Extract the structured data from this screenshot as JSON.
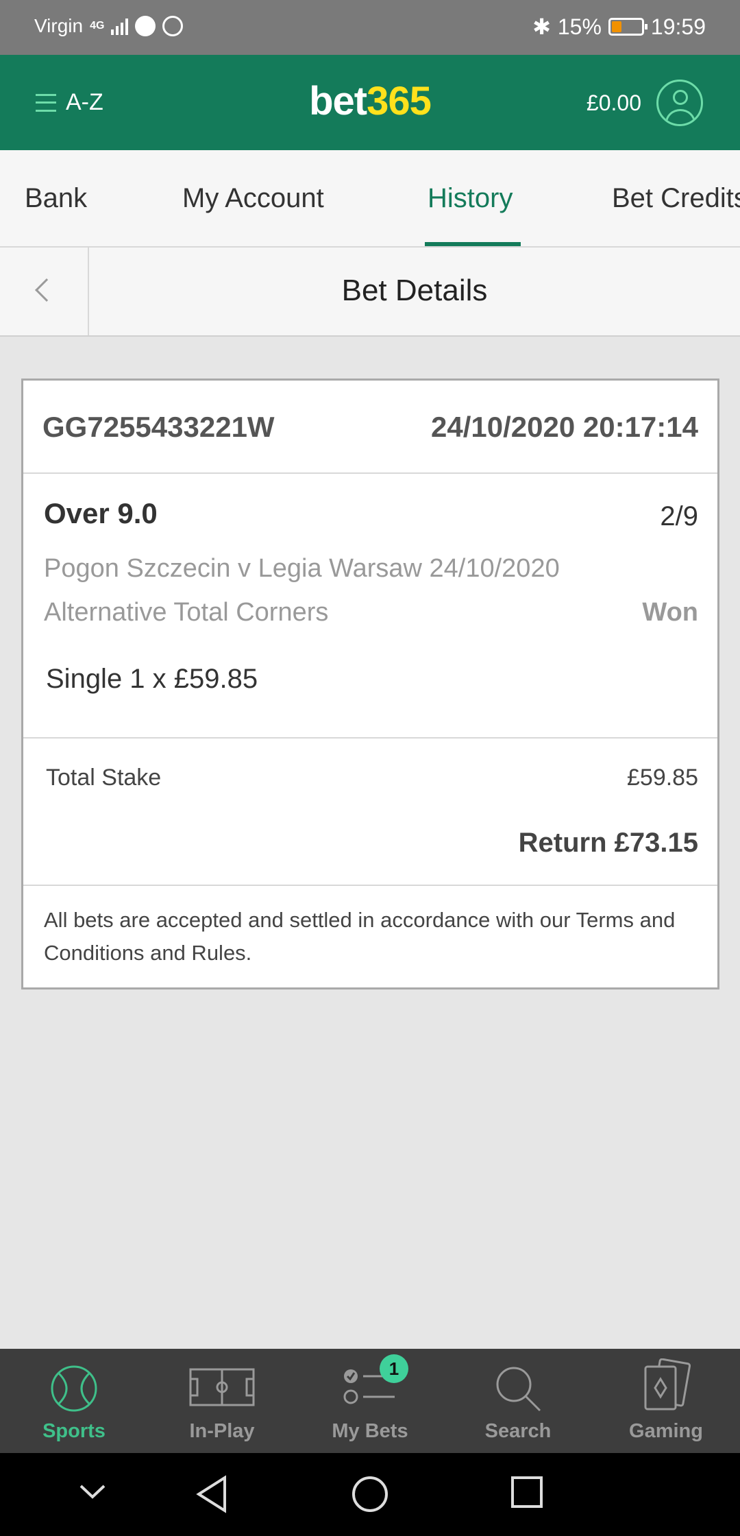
{
  "status_bar": {
    "carrier": "Virgin",
    "network": "4G",
    "battery": "15%",
    "time": "19:59",
    "colors": {
      "background": "#7a7a7a",
      "battery_charge": "#f29100"
    }
  },
  "header": {
    "menu_label": "A-Z",
    "logo_part1": "bet",
    "logo_part2": "365",
    "balance": "£0.00",
    "colors": {
      "brand_green": "#147b5a",
      "logo_yellow": "#ffe11c",
      "accent_green": "#6ddca9"
    }
  },
  "tabs": [
    {
      "label": "Bank",
      "active": false
    },
    {
      "label": "My Account",
      "active": false
    },
    {
      "label": "History",
      "active": true
    },
    {
      "label": "Bet Credits",
      "active": false
    }
  ],
  "subheader": {
    "title": "Bet Details"
  },
  "bet": {
    "reference": "GG7255433221W",
    "datetime": "24/10/2020 20:17:14",
    "selection": "Over 9.0",
    "odds": "2/9",
    "fixture": "Pogon Szczecin v Legia Warsaw 24/10/2020",
    "market": "Alternative Total Corners",
    "result": "Won",
    "bet_type": "Single 1 x £59.85",
    "total_stake_label": "Total Stake",
    "total_stake": "£59.85",
    "return": "Return £73.15",
    "terms": "All bets are accepted and settled in accordance with our Terms and Conditions and Rules."
  },
  "bottom_nav": {
    "items": [
      {
        "label": "Sports",
        "icon": "sports-ball-icon",
        "active": true
      },
      {
        "label": "In-Play",
        "icon": "pitch-icon",
        "active": false
      },
      {
        "label": "My Bets",
        "icon": "bets-list-icon",
        "active": false,
        "badge": "1"
      },
      {
        "label": "Search",
        "icon": "search-icon",
        "active": false
      },
      {
        "label": "Gaming",
        "icon": "cards-icon",
        "active": false
      }
    ],
    "colors": {
      "background": "#3d3d3d",
      "active": "#3fc08a",
      "badge": "#3fd09a"
    }
  },
  "system_nav": {
    "buttons": [
      "collapse-icon",
      "back-icon",
      "home-icon",
      "recents-icon"
    ]
  }
}
